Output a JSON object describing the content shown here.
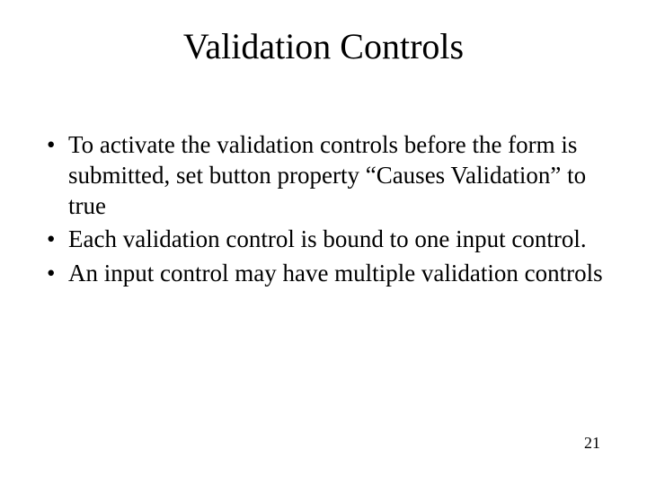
{
  "slide": {
    "title": "Validation Controls",
    "bullets": [
      "To activate the validation controls before the form is submitted, set button property “Causes Validation” to true",
      "Each validation control is bound to one input control.",
      "An input control may have multiple validation controls"
    ],
    "page_number": "21"
  }
}
